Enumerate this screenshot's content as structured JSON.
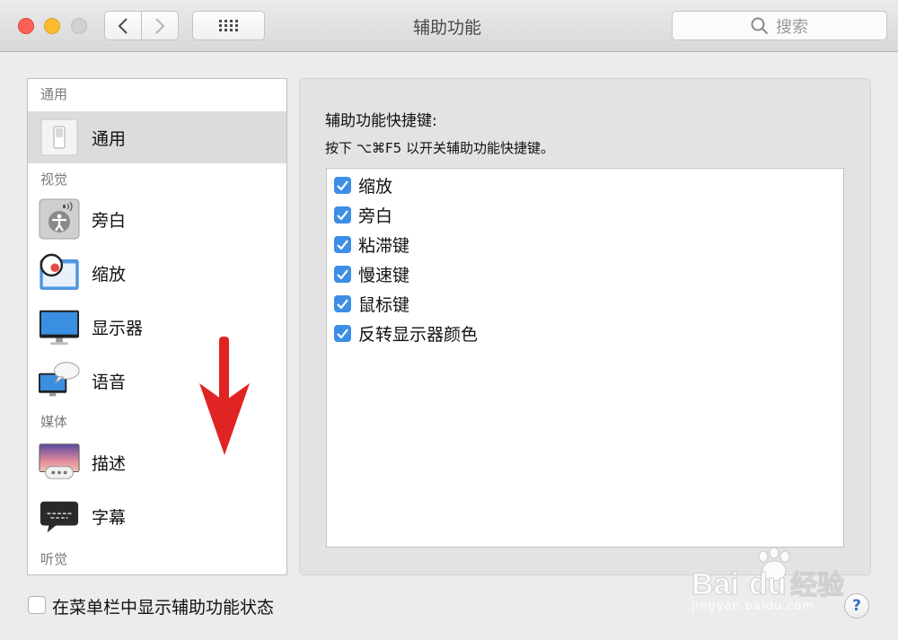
{
  "window": {
    "title": "辅助功能",
    "search_placeholder": "搜索"
  },
  "sidebar": {
    "sections": [
      {
        "header": "通用",
        "items": [
          {
            "label": "通用",
            "icon": "switch-icon",
            "selected": true
          }
        ]
      },
      {
        "header": "视觉",
        "items": [
          {
            "label": "旁白",
            "icon": "voiceover-icon"
          },
          {
            "label": "缩放",
            "icon": "zoom-icon"
          },
          {
            "label": "显示器",
            "icon": "display-icon"
          },
          {
            "label": "语音",
            "icon": "speech-icon"
          }
        ]
      },
      {
        "header": "媒体",
        "items": [
          {
            "label": "描述",
            "icon": "descriptions-icon"
          },
          {
            "label": "字幕",
            "icon": "captions-icon"
          }
        ]
      },
      {
        "header": "听觉",
        "items": []
      }
    ]
  },
  "panel": {
    "title": "辅助功能快捷键:",
    "subtitle": "按下 ⌥⌘F5 以开关辅助功能快捷键。",
    "options": [
      {
        "label": "缩放",
        "checked": true
      },
      {
        "label": "旁白",
        "checked": true
      },
      {
        "label": "粘滞键",
        "checked": true
      },
      {
        "label": "慢速键",
        "checked": true
      },
      {
        "label": "鼠标键",
        "checked": true
      },
      {
        "label": "反转显示器颜色",
        "checked": true
      }
    ]
  },
  "footer": {
    "menubar_checkbox_label": "在菜单栏中显示辅助功能状态",
    "menubar_checked": false,
    "help_label": "?"
  },
  "watermark": {
    "brand": "Baidu经验",
    "url": "jingyan.baidu.com"
  },
  "colors": {
    "accent": "#3d8ee6",
    "arrow": "#e02424"
  }
}
